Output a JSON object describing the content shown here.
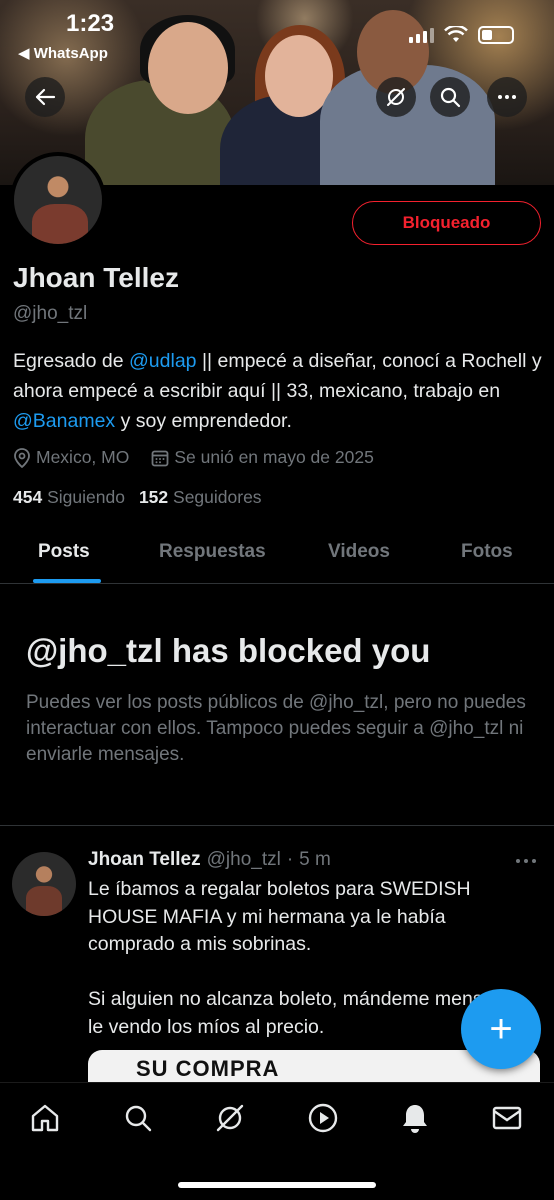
{
  "status_bar": {
    "time": "1:23",
    "back_app": "◀ WhatsApp"
  },
  "header": {
    "back_icon": "arrow-left-icon",
    "grok_icon": "grok-icon",
    "search_icon": "search-icon",
    "more_icon": "more-horizontal-icon"
  },
  "profile": {
    "name": "Jhoan Tellez",
    "handle": "@jho_tzl",
    "blocked_button": "Bloqueado",
    "bio": {
      "part1": "Egresado de ",
      "mention1": "@udlap",
      "part2": " || empecé a diseñar, conocí a Rochell y ahora empecé a escribir aquí || 33, mexicano, trabajo en ",
      "mention2": "@Banamex",
      "part3": " y soy emprendedor."
    },
    "location": "Mexico, MO",
    "joined": "Se unió en mayo de 2025",
    "following_count": "454",
    "following_label": "Siguiendo",
    "followers_count": "152",
    "followers_label": "Seguidores"
  },
  "tabs": [
    {
      "label": "Posts"
    },
    {
      "label": "Respuestas"
    },
    {
      "label": "Videos"
    },
    {
      "label": "Fotos"
    }
  ],
  "blocked_notice": {
    "title": "@jho_tzl has blocked you",
    "description": "Puedes ver los posts públicos de @jho_tzl, pero no puedes interactuar con ellos. Tampoco puedes seguir a @jho_tzl ni enviarle mensajes."
  },
  "post": {
    "author_name": "Jhoan Tellez",
    "author_handle": "@jho_tzl",
    "separator": "·",
    "time": "5 m",
    "text": "Le íbamos a regalar boletos para SWEDISH HOUSE MAFIA y mi hermana ya le había comprado a mis sobrinas.\n\nSi alguien no alcanza boleto, mándeme mensaje le vendo los míos al precio.",
    "media_text": "SU COMPRA"
  },
  "fab_label": "+",
  "bottom_nav": [
    "home-icon",
    "search-icon",
    "grok-icon",
    "video-icon",
    "notifications-icon",
    "messages-icon"
  ],
  "colors": {
    "accent": "#1d9bf0",
    "blocked_red": "#f4212e",
    "muted": "#71767b",
    "text": "#e7e9ea",
    "background": "#000000"
  }
}
